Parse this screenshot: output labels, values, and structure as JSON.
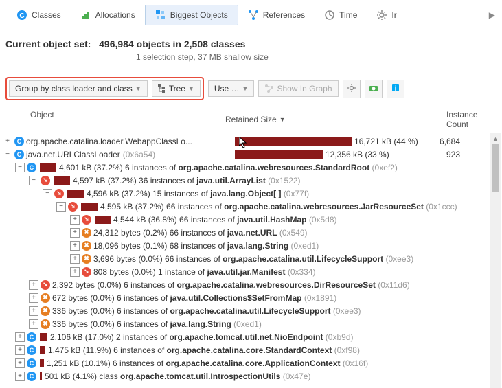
{
  "tabs": {
    "classes": "Classes",
    "allocations": "Allocations",
    "biggest": "Biggest Objects",
    "references": "References",
    "time": "Time",
    "incoming": "Ir"
  },
  "summary": {
    "label": "Current object set:",
    "value": "496,984 objects in 2,508 classes",
    "sub": "1 selection step, 37 MB shallow size"
  },
  "toolbar": {
    "group": "Group by class loader and class",
    "tree": "Tree",
    "use": "Use …",
    "show_graph": "Show In Graph"
  },
  "columns": {
    "object": "Object",
    "retained": "Retained Size",
    "instance": "Instance Count"
  },
  "rows": {
    "r0": {
      "name": "org.apache.catalina.loader.WebappClassLo...",
      "ret": "16,721 kB (44 %)",
      "inst": "6,684"
    },
    "r1": {
      "name": "java.net.URLClassLoader",
      "addr": "(0x6a54)",
      "ret": "12,356 kB (33 %)",
      "inst": "923"
    },
    "r2": {
      "pre": "4,601 kB (37.2%) 6 instances of ",
      "cls": "org.apache.catalina.webresources.StandardRoot",
      "addr": "(0xef2)"
    },
    "r3": {
      "pre": "4,597 kB (37.2%) 36 instances of ",
      "cls": "java.util.ArrayList",
      "addr": "(0x1522)"
    },
    "r4": {
      "pre": "4,596 kB (37.2%) 15 instances of ",
      "cls": "java.lang.Object[ ]",
      "addr": "(0x77f)"
    },
    "r5": {
      "pre": "4,595 kB (37.2%) 66 instances of ",
      "cls": "org.apache.catalina.webresources.JarResourceSet",
      "addr": "(0x1ccc)"
    },
    "r6": {
      "pre": "4,544 kB (36.8%) 66 instances of ",
      "cls": "java.util.HashMap",
      "addr": "(0x5d8)"
    },
    "r7": {
      "pre": "24,312 bytes (0.2%) 66 instances of ",
      "cls": "java.net.URL",
      "addr": "(0x549)"
    },
    "r8": {
      "pre": "18,096 bytes (0.1%) 68 instances of ",
      "cls": "java.lang.String",
      "addr": "(0xed1)"
    },
    "r9": {
      "pre": "3,696 bytes (0.0%) 66 instances of ",
      "cls": "org.apache.catalina.util.LifecycleSupport",
      "addr": "(0xee3)"
    },
    "r10": {
      "pre": "808 bytes (0.0%) 1 instance of ",
      "cls": "java.util.jar.Manifest",
      "addr": "(0x334)"
    },
    "r11": {
      "pre": "2,392 bytes (0.0%) 6 instances of ",
      "cls": "org.apache.catalina.webresources.DirResourceSet",
      "addr": "(0x11d6)"
    },
    "r12": {
      "pre": "672 bytes (0.0%) 6 instances of ",
      "cls": "java.util.Collections$SetFromMap",
      "addr": "(0x1891)"
    },
    "r13": {
      "pre": "336 bytes (0.0%) 6 instances of ",
      "cls": "org.apache.catalina.util.LifecycleSupport",
      "addr": "(0xee3)"
    },
    "r14": {
      "pre": "336 bytes (0.0%) 6 instances of ",
      "cls": "java.lang.String",
      "addr": "(0xed1)"
    },
    "r15": {
      "pre": "2,106 kB (17.0%) 2 instances of ",
      "cls": "org.apache.tomcat.util.net.NioEndpoint",
      "addr": "(0xb9d)"
    },
    "r16": {
      "pre": "1,475 kB (11.9%) 6 instances of ",
      "cls": "org.apache.catalina.core.StandardContext",
      "addr": "(0xf98)"
    },
    "r17": {
      "pre": "1,251 kB (10.1%) 6 instances of ",
      "cls": "org.apache.catalina.core.ApplicationContext",
      "addr": "(0x16f)"
    },
    "r18": {
      "pre": "501 kB (4.1%) class ",
      "cls": "org.apache.tomcat.util.IntrospectionUtils",
      "addr": "(0x47e)"
    }
  }
}
